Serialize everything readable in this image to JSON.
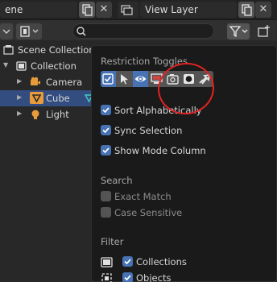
{
  "header": {
    "scene_name": "ene",
    "view_layer": "View Layer",
    "close_glyph": "✕"
  },
  "outliner": {
    "items": [
      {
        "label": "Scene Collection",
        "icon": "scene-collection-icon"
      },
      {
        "label": "Collection",
        "icon": "collection-icon"
      },
      {
        "label": "Camera",
        "icon": "camera-object-icon"
      },
      {
        "label": "Cube",
        "icon": "mesh-object-icon",
        "selected": true
      },
      {
        "label": "Light",
        "icon": "light-object-icon"
      }
    ]
  },
  "popover": {
    "restriction_title": "Restriction Toggles",
    "restriction_toggles": [
      {
        "icon": "checkbox-icon",
        "on": true
      },
      {
        "icon": "select-arrow-icon",
        "on": false
      },
      {
        "icon": "eye-icon",
        "on": true
      },
      {
        "icon": "monitor-icon",
        "on": false
      },
      {
        "icon": "camera-render-icon",
        "on": false
      },
      {
        "icon": "holdout-icon",
        "on": false
      },
      {
        "icon": "indirect-only-icon",
        "on": false
      }
    ],
    "sort_alphabetically": {
      "label": "Sort Alphabetically",
      "checked": true
    },
    "sync_selection": {
      "label": "Sync Selection",
      "checked": true
    },
    "show_mode_column": {
      "label": "Show Mode Column",
      "checked": true
    },
    "search_title": "Search",
    "exact_match": {
      "label": "Exact Match",
      "checked": false
    },
    "case_sensitive": {
      "label": "Case Sensitive",
      "checked": false
    },
    "filter_title": "Filter",
    "collections": {
      "label": "Collections",
      "checked": true
    },
    "objects": {
      "label": "Objects",
      "checked": true
    }
  },
  "colors": {
    "accent": "#4772b3",
    "selection": "#334d80",
    "annotation": "#e42222"
  }
}
